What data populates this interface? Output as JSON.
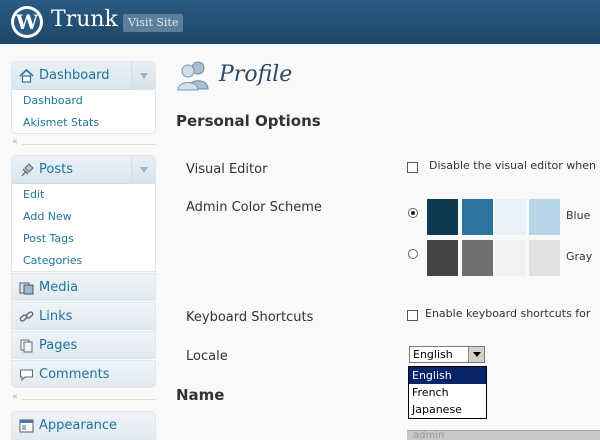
{
  "header": {
    "logo_glyph": "W",
    "site_title": "Trunk",
    "visit_site": "Visit Site"
  },
  "sidebar": {
    "dashboard": {
      "label": "Dashboard",
      "icon": "house-icon",
      "items": [
        "Dashboard",
        "Akismet Stats"
      ]
    },
    "posts": {
      "label": "Posts",
      "icon": "pushpin-icon",
      "items": [
        "Edit",
        "Add New",
        "Post Tags",
        "Categories"
      ]
    },
    "media": {
      "label": "Media",
      "icon": "media-icon"
    },
    "links": {
      "label": "Links",
      "icon": "link-icon"
    },
    "pages": {
      "label": "Pages",
      "icon": "pages-icon"
    },
    "comments": {
      "label": "Comments",
      "icon": "comment-bubble-icon"
    },
    "appearance": {
      "label": "Appearance",
      "icon": "appearance-icon"
    },
    "separator_glyph": "«"
  },
  "content": {
    "page_title": "Profile",
    "personal_options": "Personal Options",
    "visual_editor": {
      "label": "Visual Editor",
      "checkbox_label": "Disable the visual editor when",
      "checked": false
    },
    "color_scheme": {
      "label": "Admin Color Scheme",
      "options": [
        {
          "name": "Blue",
          "checked": true,
          "colors": [
            "#0d3a52",
            "#2b75a0",
            "#e9f1f8",
            "#b7d5e6"
          ]
        },
        {
          "name": "Gray",
          "checked": false,
          "colors": [
            "#444444",
            "#6e6e6e",
            "#f2f2f2",
            "#e2e2e2"
          ]
        }
      ]
    },
    "keyboard_shortcuts": {
      "label": "Keyboard Shortcuts",
      "checkbox_label": "Enable keyboard shortcuts for",
      "checked": false
    },
    "locale": {
      "label": "Locale",
      "selected": "English",
      "options": [
        "English",
        "French",
        "Japanese"
      ]
    },
    "name_section": "Name",
    "bottom_field_value": "admin"
  }
}
